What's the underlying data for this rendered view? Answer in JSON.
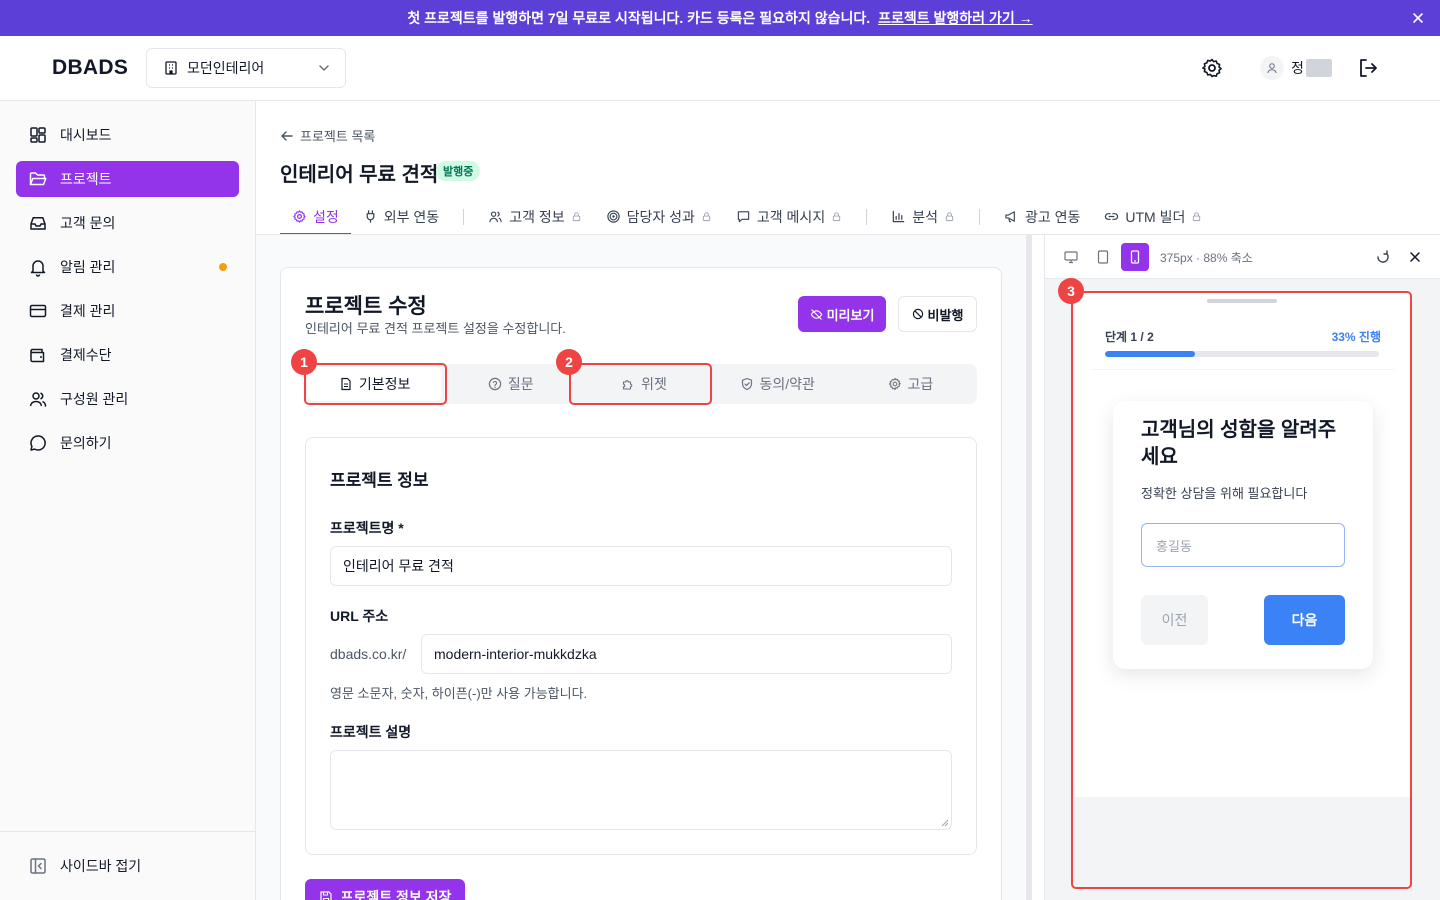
{
  "banner": {
    "text": "첫 프로젝트를 발행하면 7일 무료로 시작됩니다. 카드 등록은 필요하지 않습니다.",
    "link": "프로젝트 발행하러 가기 →"
  },
  "header": {
    "logo": "DBADS",
    "org": "모던인테리어",
    "user_name": "정"
  },
  "sidebar": {
    "items": [
      {
        "label": "대시보드"
      },
      {
        "label": "프로젝트"
      },
      {
        "label": "고객 문의"
      },
      {
        "label": "알림 관리"
      },
      {
        "label": "결제 관리"
      },
      {
        "label": "결제수단"
      },
      {
        "label": "구성원 관리"
      },
      {
        "label": "문의하기"
      }
    ],
    "collapse": "사이드바 접기"
  },
  "page": {
    "back": "프로젝트 목록",
    "title": "인테리어 무료 견적",
    "status": "발행중"
  },
  "tabs": [
    {
      "label": "설정"
    },
    {
      "label": "외부 연동"
    },
    {
      "label": "고객 정보"
    },
    {
      "label": "담당자 성과"
    },
    {
      "label": "고객 메시지"
    },
    {
      "label": "분석"
    },
    {
      "label": "광고 연동"
    },
    {
      "label": "UTM 빌더"
    }
  ],
  "editor": {
    "title": "프로젝트 수정",
    "subtitle": "인테리어 무료 견적 프로젝트 설정을 수정합니다.",
    "preview_btn": "미리보기",
    "unpublish_btn": "비발행",
    "subtabs": [
      {
        "label": "기본정보"
      },
      {
        "label": "질문"
      },
      {
        "label": "위젯"
      },
      {
        "label": "동의/약관"
      },
      {
        "label": "고급"
      }
    ],
    "markers": [
      "1",
      "2",
      "3"
    ],
    "section_title": "프로젝트 정보",
    "name_label": "프로젝트명 *",
    "name_value": "인테리어 무료 견적",
    "url_label": "URL 주소",
    "url_prefix": "dbads.co.kr/",
    "url_value": "modern-interior-mukkdzka",
    "url_help": "영문 소문자, 숫자, 하이픈(-)만 사용 가능합니다.",
    "desc_label": "프로젝트 설명",
    "save_btn": "프로젝트 정보 저장"
  },
  "preview": {
    "info": "375px · 88% 축소",
    "step": "단계 1 / 2",
    "progress_text": "33% 진행",
    "progress": 0.33,
    "question": "고객님의 성함을 알려주세요",
    "question_sub": "정확한 상담을 위해 필요합니다",
    "placeholder": "홍길동",
    "prev": "이전",
    "next": "다음"
  },
  "colors": {
    "banner": "#5b3fd6",
    "accent": "#9333ea",
    "highlight": "#ef4444",
    "widget_blue": "#3b82f6",
    "status_green": "#047857"
  }
}
